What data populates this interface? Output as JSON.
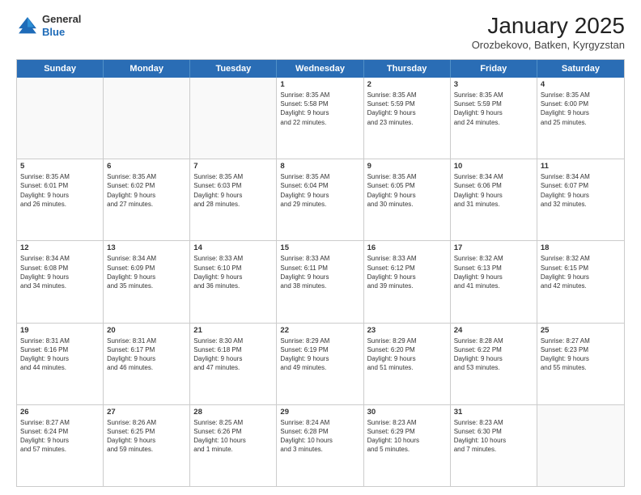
{
  "header": {
    "logo_line1": "General",
    "logo_line2": "Blue",
    "title": "January 2025",
    "subtitle": "Orozbekovo, Batken, Kyrgyzstan"
  },
  "days_of_week": [
    "Sunday",
    "Monday",
    "Tuesday",
    "Wednesday",
    "Thursday",
    "Friday",
    "Saturday"
  ],
  "weeks": [
    [
      {
        "day": "",
        "text": ""
      },
      {
        "day": "",
        "text": ""
      },
      {
        "day": "",
        "text": ""
      },
      {
        "day": "1",
        "text": "Sunrise: 8:35 AM\nSunset: 5:58 PM\nDaylight: 9 hours\nand 22 minutes."
      },
      {
        "day": "2",
        "text": "Sunrise: 8:35 AM\nSunset: 5:59 PM\nDaylight: 9 hours\nand 23 minutes."
      },
      {
        "day": "3",
        "text": "Sunrise: 8:35 AM\nSunset: 5:59 PM\nDaylight: 9 hours\nand 24 minutes."
      },
      {
        "day": "4",
        "text": "Sunrise: 8:35 AM\nSunset: 6:00 PM\nDaylight: 9 hours\nand 25 minutes."
      }
    ],
    [
      {
        "day": "5",
        "text": "Sunrise: 8:35 AM\nSunset: 6:01 PM\nDaylight: 9 hours\nand 26 minutes."
      },
      {
        "day": "6",
        "text": "Sunrise: 8:35 AM\nSunset: 6:02 PM\nDaylight: 9 hours\nand 27 minutes."
      },
      {
        "day": "7",
        "text": "Sunrise: 8:35 AM\nSunset: 6:03 PM\nDaylight: 9 hours\nand 28 minutes."
      },
      {
        "day": "8",
        "text": "Sunrise: 8:35 AM\nSunset: 6:04 PM\nDaylight: 9 hours\nand 29 minutes."
      },
      {
        "day": "9",
        "text": "Sunrise: 8:35 AM\nSunset: 6:05 PM\nDaylight: 9 hours\nand 30 minutes."
      },
      {
        "day": "10",
        "text": "Sunrise: 8:34 AM\nSunset: 6:06 PM\nDaylight: 9 hours\nand 31 minutes."
      },
      {
        "day": "11",
        "text": "Sunrise: 8:34 AM\nSunset: 6:07 PM\nDaylight: 9 hours\nand 32 minutes."
      }
    ],
    [
      {
        "day": "12",
        "text": "Sunrise: 8:34 AM\nSunset: 6:08 PM\nDaylight: 9 hours\nand 34 minutes."
      },
      {
        "day": "13",
        "text": "Sunrise: 8:34 AM\nSunset: 6:09 PM\nDaylight: 9 hours\nand 35 minutes."
      },
      {
        "day": "14",
        "text": "Sunrise: 8:33 AM\nSunset: 6:10 PM\nDaylight: 9 hours\nand 36 minutes."
      },
      {
        "day": "15",
        "text": "Sunrise: 8:33 AM\nSunset: 6:11 PM\nDaylight: 9 hours\nand 38 minutes."
      },
      {
        "day": "16",
        "text": "Sunrise: 8:33 AM\nSunset: 6:12 PM\nDaylight: 9 hours\nand 39 minutes."
      },
      {
        "day": "17",
        "text": "Sunrise: 8:32 AM\nSunset: 6:13 PM\nDaylight: 9 hours\nand 41 minutes."
      },
      {
        "day": "18",
        "text": "Sunrise: 8:32 AM\nSunset: 6:15 PM\nDaylight: 9 hours\nand 42 minutes."
      }
    ],
    [
      {
        "day": "19",
        "text": "Sunrise: 8:31 AM\nSunset: 6:16 PM\nDaylight: 9 hours\nand 44 minutes."
      },
      {
        "day": "20",
        "text": "Sunrise: 8:31 AM\nSunset: 6:17 PM\nDaylight: 9 hours\nand 46 minutes."
      },
      {
        "day": "21",
        "text": "Sunrise: 8:30 AM\nSunset: 6:18 PM\nDaylight: 9 hours\nand 47 minutes."
      },
      {
        "day": "22",
        "text": "Sunrise: 8:29 AM\nSunset: 6:19 PM\nDaylight: 9 hours\nand 49 minutes."
      },
      {
        "day": "23",
        "text": "Sunrise: 8:29 AM\nSunset: 6:20 PM\nDaylight: 9 hours\nand 51 minutes."
      },
      {
        "day": "24",
        "text": "Sunrise: 8:28 AM\nSunset: 6:22 PM\nDaylight: 9 hours\nand 53 minutes."
      },
      {
        "day": "25",
        "text": "Sunrise: 8:27 AM\nSunset: 6:23 PM\nDaylight: 9 hours\nand 55 minutes."
      }
    ],
    [
      {
        "day": "26",
        "text": "Sunrise: 8:27 AM\nSunset: 6:24 PM\nDaylight: 9 hours\nand 57 minutes."
      },
      {
        "day": "27",
        "text": "Sunrise: 8:26 AM\nSunset: 6:25 PM\nDaylight: 9 hours\nand 59 minutes."
      },
      {
        "day": "28",
        "text": "Sunrise: 8:25 AM\nSunset: 6:26 PM\nDaylight: 10 hours\nand 1 minute."
      },
      {
        "day": "29",
        "text": "Sunrise: 8:24 AM\nSunset: 6:28 PM\nDaylight: 10 hours\nand 3 minutes."
      },
      {
        "day": "30",
        "text": "Sunrise: 8:23 AM\nSunset: 6:29 PM\nDaylight: 10 hours\nand 5 minutes."
      },
      {
        "day": "31",
        "text": "Sunrise: 8:23 AM\nSunset: 6:30 PM\nDaylight: 10 hours\nand 7 minutes."
      },
      {
        "day": "",
        "text": ""
      }
    ]
  ]
}
